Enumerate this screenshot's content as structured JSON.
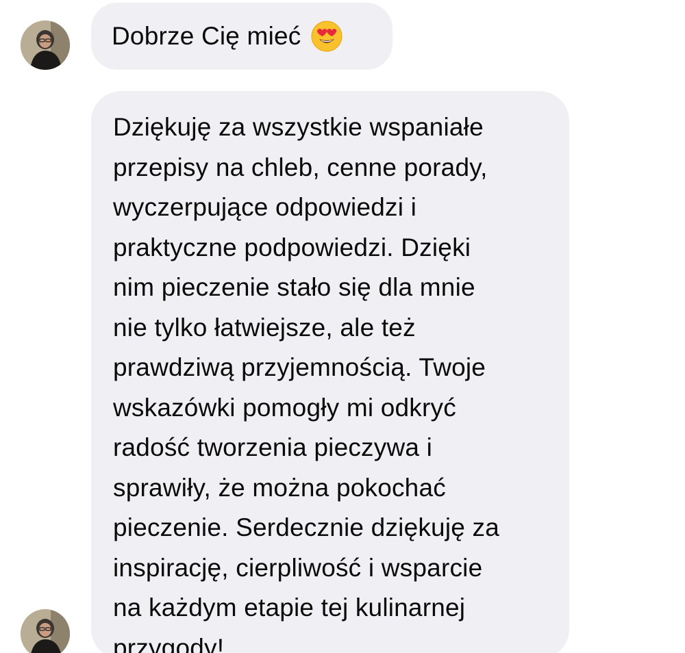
{
  "messages": [
    {
      "text": "Dobrze Cię mieć",
      "emoji": "heart-eyes-emoji"
    },
    {
      "lines": [
        "Dziękuję za wszystkie wspaniałe",
        "przepisy na chleb, cenne porady,",
        "wyczerpujące odpowiedzi i",
        "praktyczne podpowiedzi. Dzięki",
        "nim pieczenie stało się dla mnie",
        "nie tylko łatwiejsze, ale też",
        "prawdziwą przyjemnością. Twoje",
        "wskazówki pomogły mi odkryć",
        "radość tworzenia pieczywa i",
        "sprawiły, że można pokochać",
        "pieczenie. Serdecznie dziękuję za",
        "inspirację, cierpliwość i wsparcie",
        "na każdym etapie tej kulinarnej",
        "przygody!"
      ]
    }
  ],
  "colors": {
    "bubble": "#f0f0f4",
    "text": "#0a0a0a",
    "background": "#ffffff"
  }
}
